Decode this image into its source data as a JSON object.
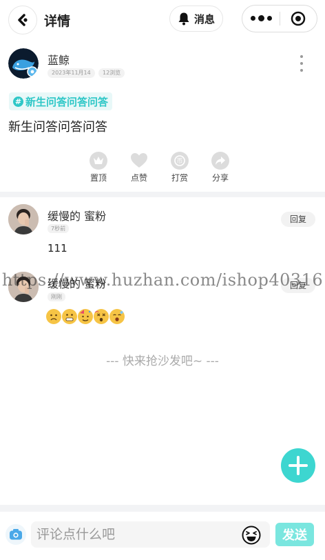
{
  "header": {
    "title": "详情",
    "message_label": "消息"
  },
  "post": {
    "author": "蓝鲸",
    "date": "2023年11月14",
    "views": "12浏览",
    "topic": "新生问答问答问答",
    "content": "新生问答问答问答",
    "actions": [
      {
        "icon": "crown-icon",
        "label": "置顶"
      },
      {
        "icon": "heart-icon",
        "label": "点赞"
      },
      {
        "icon": "coin-icon",
        "label": "打赏"
      },
      {
        "icon": "share-icon",
        "label": "分享"
      }
    ]
  },
  "comments": [
    {
      "name": "缓慢的 蜜粉",
      "time": "7秒前",
      "reply_label": "回复",
      "text": "111"
    },
    {
      "name": "缓慢的 蜜粉",
      "time": "刚刚",
      "reply_label": "回复",
      "emojis": [
        "worried-face",
        "grimacing-face",
        "partying-face",
        "dizzy-face",
        "yawning-face"
      ]
    }
  ],
  "empty_hint": "--- 快来抢沙发吧~ ---",
  "watermark": "https://www.huzhan.com/ishop40316",
  "bottom_bar": {
    "placeholder": "评论点什么吧",
    "send_label": "发送"
  },
  "colors": {
    "accent": "#3dd6d0",
    "send": "#7ae6df",
    "topic": "#2ec7c7"
  }
}
